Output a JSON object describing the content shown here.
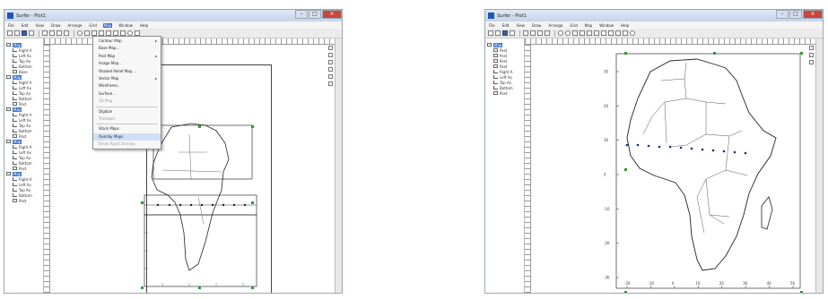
{
  "left_window": {
    "title": "Surfer - Plot1",
    "menu": [
      "File",
      "Edit",
      "View",
      "Draw",
      "Arrange",
      "Grid",
      "Map",
      "Window",
      "Help"
    ],
    "active_menu": "Map",
    "tree_items": [
      {
        "label": "Map",
        "level": 0,
        "type": "map",
        "selected": true
      },
      {
        "label": "Right A",
        "level": 1,
        "type": "axis"
      },
      {
        "label": "Left Ax",
        "level": 1,
        "type": "axis"
      },
      {
        "label": "Top Ax",
        "level": 1,
        "type": "axis"
      },
      {
        "label": "Bottom",
        "level": 1,
        "type": "axis"
      },
      {
        "label": "Base",
        "level": 1,
        "type": "layer"
      },
      {
        "label": "Map",
        "level": 0,
        "type": "map",
        "selected": true
      },
      {
        "label": "Right A",
        "level": 1,
        "type": "axis"
      },
      {
        "label": "Left Ax",
        "level": 1,
        "type": "axis"
      },
      {
        "label": "Top Ax",
        "level": 1,
        "type": "axis"
      },
      {
        "label": "Bottom",
        "level": 1,
        "type": "axis"
      },
      {
        "label": "Post",
        "level": 1,
        "type": "layer"
      },
      {
        "label": "Map",
        "level": 0,
        "type": "map",
        "selected": true
      },
      {
        "label": "Right A",
        "level": 1,
        "type": "axis"
      },
      {
        "label": "Left Ax",
        "level": 1,
        "type": "axis"
      },
      {
        "label": "Top Ax",
        "level": 1,
        "type": "axis"
      },
      {
        "label": "Bottom",
        "level": 1,
        "type": "axis"
      },
      {
        "label": "Post",
        "level": 1,
        "type": "layer"
      },
      {
        "label": "Map",
        "level": 0,
        "type": "map",
        "selected": true
      },
      {
        "label": "Right A",
        "level": 1,
        "type": "axis"
      },
      {
        "label": "Left Ax",
        "level": 1,
        "type": "axis"
      },
      {
        "label": "Top Ax",
        "level": 1,
        "type": "axis"
      },
      {
        "label": "Bottom",
        "level": 1,
        "type": "axis"
      },
      {
        "label": "Post",
        "level": 1,
        "type": "layer"
      },
      {
        "label": "Map",
        "level": 0,
        "type": "map",
        "selected": true
      },
      {
        "label": "Right A",
        "level": 1,
        "type": "axis"
      },
      {
        "label": "Left Ax",
        "level": 1,
        "type": "axis"
      },
      {
        "label": "Top Ax",
        "level": 1,
        "type": "axis"
      },
      {
        "label": "Bottom",
        "level": 1,
        "type": "axis"
      },
      {
        "label": "Post",
        "level": 1,
        "type": "layer"
      }
    ],
    "map_menu": [
      {
        "label": "Contour Map",
        "submenu": true
      },
      {
        "label": "Base Map...",
        "submenu": false
      },
      {
        "label": "Post Map",
        "submenu": true
      },
      {
        "label": "Image Map...",
        "submenu": false
      },
      {
        "label": "Shaded Relief Map...",
        "submenu": false
      },
      {
        "label": "Vector Map",
        "submenu": true
      },
      {
        "label": "Wireframe...",
        "submenu": false
      },
      {
        "label": "Surface...",
        "submenu": false
      },
      {
        "label": "3D Map",
        "submenu": false,
        "disabled": true
      },
      {
        "separator": true
      },
      {
        "label": "Digitize",
        "submenu": false
      },
      {
        "label": "Trackball",
        "submenu": false,
        "disabled": true
      },
      {
        "separator": true
      },
      {
        "label": "Stack Maps",
        "submenu": false
      },
      {
        "label": "Overlay Maps",
        "submenu": false,
        "highlighted": true
      },
      {
        "label": "Break Apart Overlay",
        "submenu": false,
        "disabled": true
      }
    ]
  },
  "right_window": {
    "title": "Surfer - Plot1",
    "menu": [
      "File",
      "Edit",
      "View",
      "Draw",
      "Arrange",
      "Grid",
      "Map",
      "Window",
      "Help"
    ],
    "tree_items": [
      {
        "label": "Map",
        "level": 0,
        "type": "map",
        "selected": true
      },
      {
        "label": "Post",
        "level": 1,
        "type": "layer"
      },
      {
        "label": "Post",
        "level": 1,
        "type": "layer"
      },
      {
        "label": "Post",
        "level": 1,
        "type": "layer"
      },
      {
        "label": "Post",
        "level": 1,
        "type": "layer"
      },
      {
        "label": "Right A",
        "level": 1,
        "type": "axis"
      },
      {
        "label": "Left Ax",
        "level": 1,
        "type": "axis"
      },
      {
        "label": "Top Ax",
        "level": 1,
        "type": "axis"
      },
      {
        "label": "Bottom",
        "level": 1,
        "type": "axis"
      },
      {
        "label": "Post",
        "level": 1,
        "type": "layer"
      }
    ],
    "stations_label": "+ + + + + + + + + + + + +",
    "y_ticks": [
      "30",
      "20",
      "10",
      "0",
      "-10",
      "-20",
      "-30"
    ],
    "x_ticks": [
      "-20",
      "-10",
      "0",
      "10",
      "20",
      "30",
      "40",
      "50"
    ]
  },
  "colors": {
    "selection": "#3b6fc9",
    "handle": "#2d9a3a",
    "station": "#1a2a8c",
    "title_bar": "#c6d4e8"
  }
}
